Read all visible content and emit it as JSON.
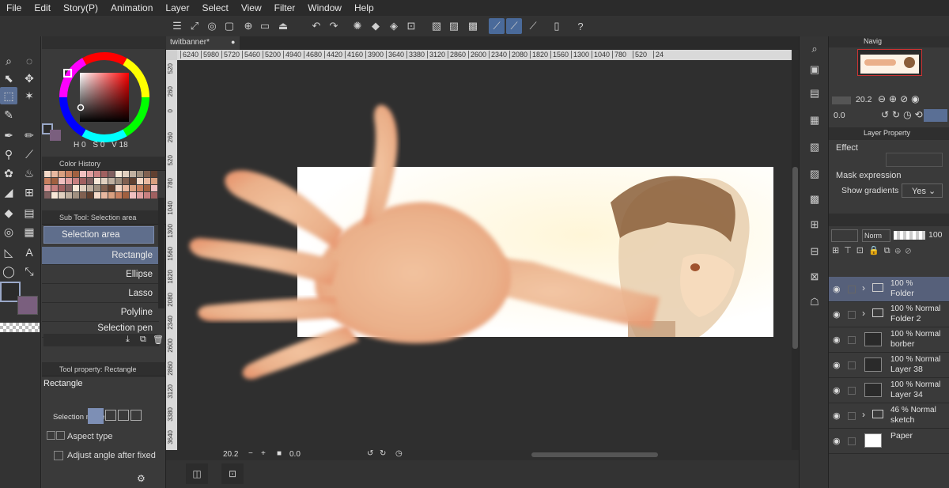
{
  "menu": [
    "File",
    "Edit",
    "Story(P)",
    "Animation",
    "Layer",
    "Select",
    "View",
    "Filter",
    "Window",
    "Help"
  ],
  "document": {
    "tab": "twitbanner*"
  },
  "ruler": {
    "ticks": [
      "6240",
      "5980",
      "5720",
      "5460",
      "5200",
      "4940",
      "4680",
      "4420",
      "4160",
      "3900",
      "3640",
      "3380",
      "3120",
      "2860",
      "2600",
      "2340",
      "2080",
      "1820",
      "1560",
      "1300",
      "1040",
      "780",
      "520",
      "24"
    ],
    "left_ticks": [
      "520",
      "260",
      "0",
      "260",
      "520",
      "780",
      "1040",
      "1300",
      "1560",
      "1820",
      "2080",
      "2340",
      "2600",
      "2860",
      "3120",
      "3380",
      "3640"
    ]
  },
  "color_wheel": {
    "h_label": "H",
    "h": "0",
    "s_label": "S",
    "s": "0",
    "v_label": "V",
    "v": "18"
  },
  "panels": {
    "color_history": "Color History",
    "sub_tool": "Sub Tool: Selection area",
    "tool_property": "Tool property: Rectangle"
  },
  "subtool": {
    "group": "Selection area",
    "items": [
      "Rectangle",
      "Ellipse",
      "Lasso",
      "Polyline",
      "Selection pen"
    ]
  },
  "toolprop": {
    "name": "Rectangle",
    "selection_label": "Selection mode",
    "aspect": "Aspect type",
    "adjust": "Adjust angle after fixed"
  },
  "status": {
    "zoom": "20.2",
    "angle": "0.0"
  },
  "navigator": {
    "title": "Navig",
    "zoom": "20.2",
    "angle": "0.0"
  },
  "layer_property": {
    "title": "Layer Property",
    "effect": "Effect",
    "mask_expression": "Mask expression",
    "show_gradients": "Show gradients",
    "show_gradients_value": "Yes"
  },
  "layers_toolbar": {
    "blend": "Norm",
    "opacity": "100"
  },
  "layers": [
    {
      "pct": "100 %",
      "mode": "",
      "name": "Folder",
      "type": "folder",
      "selected": true
    },
    {
      "pct": "100 %",
      "mode": "Normal",
      "name": "Folder 2",
      "type": "folder",
      "selected": false
    },
    {
      "pct": "100 %",
      "mode": "Normal",
      "name": "borber",
      "type": "raster",
      "selected": false
    },
    {
      "pct": "100 %",
      "mode": "Normal",
      "name": "Layer 38",
      "type": "raster",
      "selected": false
    },
    {
      "pct": "100 %",
      "mode": "Normal",
      "name": "Layer 34",
      "type": "raster",
      "selected": false
    },
    {
      "pct": "46 %",
      "mode": "Normal",
      "name": "sketch",
      "type": "folder",
      "selected": false
    },
    {
      "pct": "",
      "mode": "",
      "name": "Paper",
      "type": "paper",
      "selected": false
    }
  ],
  "colors": {
    "accent": "#5a6f95",
    "selected_layer": "#56607a",
    "canvas_bg": "#2f2f2f"
  }
}
